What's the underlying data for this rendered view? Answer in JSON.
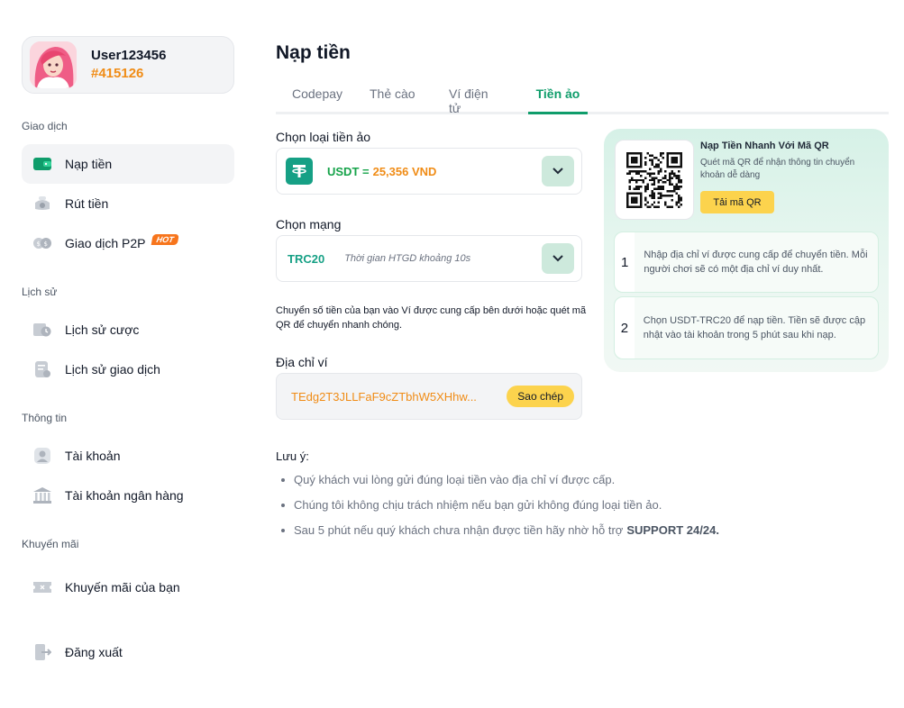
{
  "user": {
    "name": "User123456",
    "id": "#415126"
  },
  "sidebar": {
    "sections": [
      {
        "title": "Giao dịch"
      },
      {
        "title": "Lịch sử"
      },
      {
        "title": "Thông tin"
      },
      {
        "title": "Khuyến mãi"
      }
    ],
    "items": [
      {
        "label": "Nạp tiền",
        "icon": "wallet-icon"
      },
      {
        "label": "Rút tiền",
        "icon": "money-icon"
      },
      {
        "label": "Giao dịch P2P",
        "icon": "exchange-icon",
        "badge": "HOT"
      },
      {
        "label": "Lịch sử cược",
        "icon": "history-icon"
      },
      {
        "label": "Lịch sử giao dịch",
        "icon": "receipt-icon"
      },
      {
        "label": "Tài khoản",
        "icon": "user-icon"
      },
      {
        "label": "Tài khoản ngân hàng",
        "icon": "bank-icon"
      },
      {
        "label": "Khuyến mãi của bạn",
        "icon": "ticket-icon"
      },
      {
        "label": "Đăng xuất",
        "icon": "logout-icon"
      }
    ]
  },
  "page": {
    "title": "Nạp tiền"
  },
  "tabs": [
    "Codepay",
    "Thẻ cào",
    "Ví điện tử",
    "Tiền ảo"
  ],
  "crypto": {
    "label": "Chọn loại tiền ảo",
    "coin": "USDT =",
    "rate": "25,356 VND"
  },
  "network": {
    "label": "Chọn mạng",
    "name": "TRC20",
    "hint": "Thời gian HTGD khoảng 10s"
  },
  "description": "Chuyển số tiền của bạn vào Ví được cung cấp bên dưới hoặc quét mã QR để chuyển nhanh chóng.",
  "wallet": {
    "label": "Địa chỉ ví",
    "address": "TEdg2T3JLLFaF9cZTbhW5XHhw...",
    "copy": "Sao chép"
  },
  "notes": {
    "title": "Lưu ý:",
    "items": [
      "Quý khách vui lòng gửi đúng loại tiền vào địa chỉ ví được cấp.",
      "Chúng tôi không chịu trách nhiệm nếu bạn gửi không đúng loại tiền ảo.",
      "Sau 5 phút nếu quý khách chưa nhận được tiền hãy nhờ hỗ trợ"
    ],
    "support": "SUPPORT 24/24."
  },
  "qr": {
    "title": "Nạp Tiền Nhanh Với Mã QR",
    "subtitle": "Quét mã QR để nhận thông tin chuyển khoản dễ dàng",
    "button": "Tải mã QR"
  },
  "steps": [
    {
      "num": "1",
      "text": "Nhập địa chỉ ví được cung cấp để chuyển tiền. Mỗi người chơi sẽ có một địa chỉ ví duy nhất."
    },
    {
      "num": "2",
      "text": "Chọn USDT-TRC20 để nạp tiền. Tiền sẽ được cập nhật vào tài khoản trong 5 phút sau khi nạp."
    }
  ],
  "colors": {
    "accent": "#0f9d6b",
    "highlight": "#f08c16",
    "button": "#fcd34d"
  }
}
